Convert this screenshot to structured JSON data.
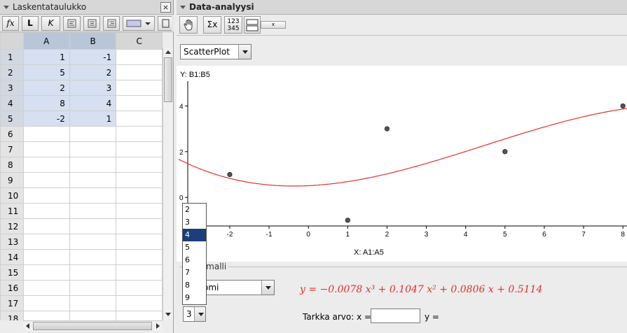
{
  "spreadsheet": {
    "title": "Laskentataulukko",
    "close_label": "×",
    "toolbar": {
      "fx": "fx",
      "bold": "L",
      "italic": "K"
    },
    "columns": [
      "A",
      "B",
      "C"
    ],
    "rows": [
      {
        "n": "1",
        "a": "1",
        "b": "-1"
      },
      {
        "n": "2",
        "a": "5",
        "b": "2"
      },
      {
        "n": "3",
        "a": "2",
        "b": "3"
      },
      {
        "n": "4",
        "a": "8",
        "b": "4"
      },
      {
        "n": "5",
        "a": "-2",
        "b": "1"
      },
      {
        "n": "6",
        "a": "",
        "b": ""
      },
      {
        "n": "7",
        "a": "",
        "b": ""
      },
      {
        "n": "8",
        "a": "",
        "b": ""
      },
      {
        "n": "9",
        "a": "",
        "b": ""
      },
      {
        "n": "10",
        "a": "",
        "b": ""
      },
      {
        "n": "11",
        "a": "",
        "b": ""
      },
      {
        "n": "12",
        "a": "",
        "b": ""
      },
      {
        "n": "13",
        "a": "",
        "b": ""
      },
      {
        "n": "14",
        "a": "",
        "b": ""
      },
      {
        "n": "15",
        "a": "",
        "b": ""
      },
      {
        "n": "16",
        "a": "",
        "b": ""
      },
      {
        "n": "17",
        "a": "",
        "b": ""
      },
      {
        "n": "18",
        "a": "",
        "b": ""
      }
    ],
    "selected_rows": 5
  },
  "analysis": {
    "title": "Data-analyysi",
    "toolbar": {
      "sum_label": "Σx",
      "stats_label": "123\n345",
      "slider_label": "x"
    },
    "plot_type": "ScatterPlot",
    "y_label": "Y:  B1:B5",
    "x_label": "X:  A1:A5",
    "regression_legend": "ssiomalli",
    "regression_model": "omi",
    "equation": "y = −0.0078 x³ + 0.1047 x² + 0.0806 x + 0.5114",
    "exact_value_label": "Tarkka arvo:  x =",
    "y_eq_label": "y =",
    "degree_selected": "3",
    "degree_options": [
      "2",
      "3",
      "4",
      "5",
      "6",
      "7",
      "8",
      "9"
    ],
    "degree_highlight": "4"
  },
  "chart_data": {
    "type": "scatter",
    "x": [
      1,
      5,
      2,
      8,
      -2
    ],
    "y": [
      -1,
      2,
      3,
      4,
      1
    ],
    "fit": {
      "type": "polynomial",
      "coefficients": [
        -0.0078,
        0.1047,
        0.0806,
        0.5114
      ]
    },
    "x_ticks": [
      "-3",
      "-2",
      "-1",
      "0",
      "1",
      "2",
      "3",
      "4",
      "5",
      "6",
      "7",
      "8"
    ],
    "y_ticks": [
      "0",
      "2",
      "4"
    ],
    "xlim": [
      -3.3,
      8.05
    ],
    "ylim": [
      -1.25,
      4.9
    ],
    "fit_color": "#e0302c",
    "point_color": "#555555"
  }
}
